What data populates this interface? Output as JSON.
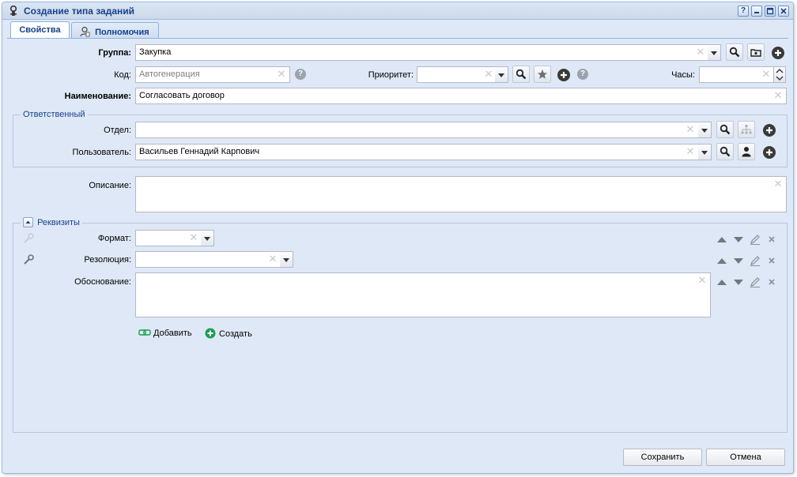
{
  "window": {
    "title": "Создание типа заданий",
    "tool_help": "?",
    "tool_min": "–",
    "tool_max": "□",
    "tool_close": "✕"
  },
  "tabs": [
    {
      "label": "Свойства",
      "active": true
    },
    {
      "label": "Полномочия",
      "active": false
    }
  ],
  "form": {
    "group": {
      "label": "Группа:",
      "value": "Закупка"
    },
    "code": {
      "label": "Код:",
      "placeholder": "Автогенерация"
    },
    "priority": {
      "label": "Приоритет:",
      "value": ""
    },
    "hours": {
      "label": "Часы:",
      "value": ""
    },
    "name": {
      "label": "Наименование:",
      "value": "Согласовать договор"
    },
    "responsible": {
      "legend": "Ответственный",
      "department": {
        "label": "Отдел:",
        "value": ""
      },
      "user": {
        "label": "Пользователь:",
        "value": "Васильев Геннадий Карпович"
      }
    },
    "description": {
      "label": "Описание:",
      "value": ""
    },
    "requisites": {
      "legend": "Реквизиты",
      "format": {
        "label": "Формат:",
        "value": ""
      },
      "resolution": {
        "label": "Резолюция:",
        "value": ""
      },
      "justification": {
        "label": "Обоснование:",
        "value": ""
      },
      "add_label": "Добавить",
      "create_label": "Создать"
    }
  },
  "footer": {
    "save_label": "Сохранить",
    "cancel_label": "Отмена"
  },
  "colors": {
    "window_bg": "#dfe8f6",
    "title_text": "#15428b",
    "field_border": "#b5b8c8",
    "add_green": "#1a9e4f"
  }
}
